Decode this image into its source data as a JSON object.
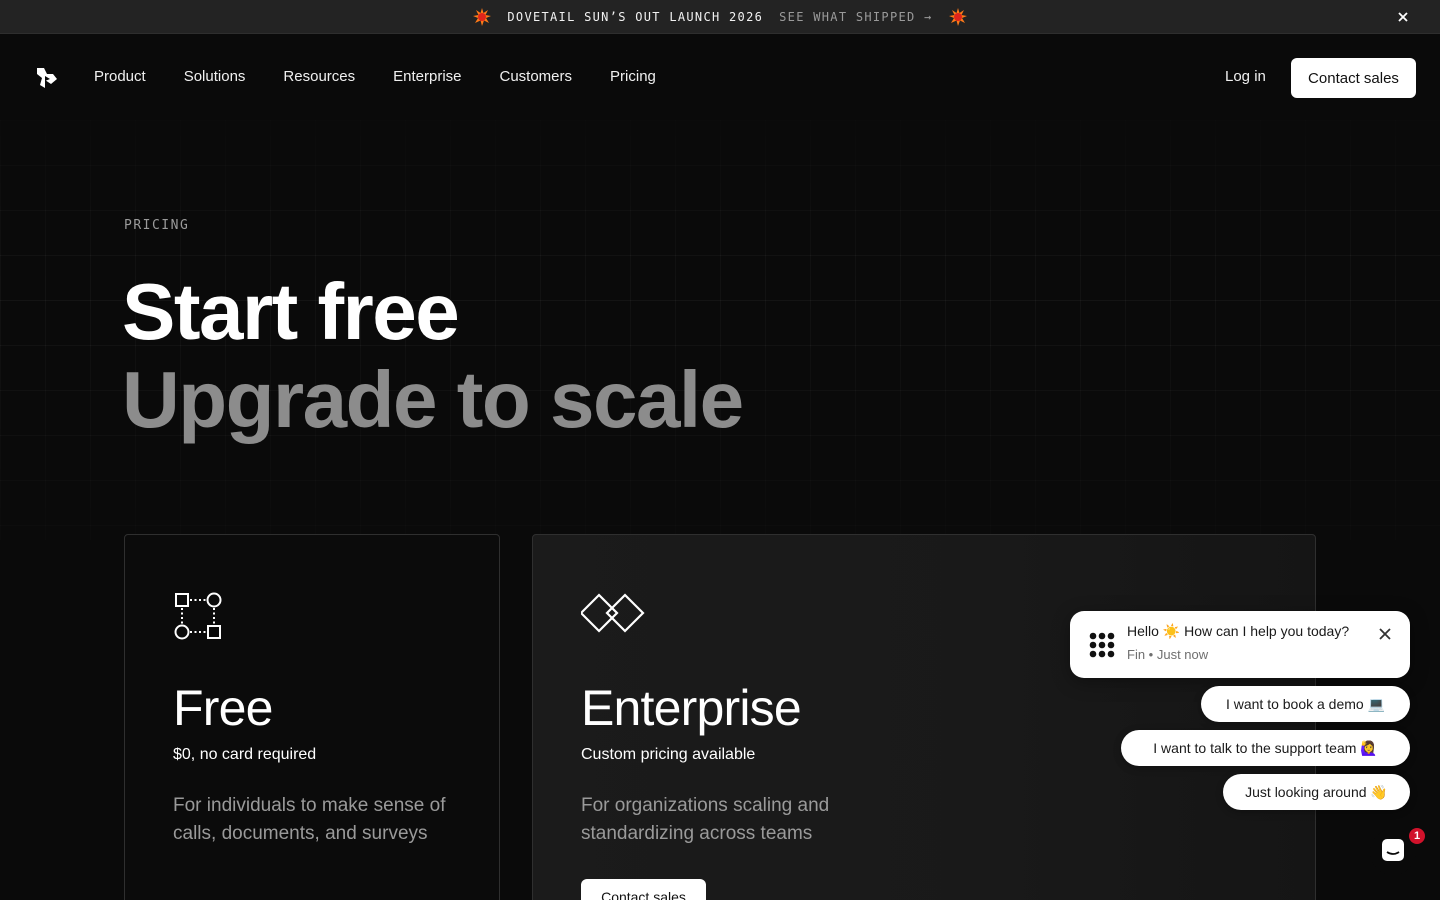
{
  "announcement": {
    "title": "DOVETAIL SUN’S OUT LAUNCH 2026",
    "link": "SEE WHAT SHIPPED →"
  },
  "nav": {
    "links": [
      "Product",
      "Solutions",
      "Resources",
      "Enterprise",
      "Customers",
      "Pricing"
    ],
    "login": "Log in",
    "contact": "Contact sales"
  },
  "hero": {
    "eyebrow": "PRICING",
    "line1": "Start free",
    "line2": "Upgrade to scale"
  },
  "plans": [
    {
      "name": "Free",
      "price": "$0, no card required",
      "description": "For individuals to make sense of calls, documents, and surveys"
    },
    {
      "name": "Enterprise",
      "price": "Custom pricing available",
      "description": "For organizations scaling and standardizing across teams",
      "cta": "Contact sales"
    }
  ],
  "chat": {
    "message": "Hello ☀️ How can I help you today?",
    "sender": "Fin",
    "time": "Just now",
    "meta": "Fin • Just now",
    "options": [
      "I want to book a demo 💻",
      "I want to talk to the support team 🙋‍♀️",
      "Just looking around 👋"
    ],
    "unread_count": "1"
  },
  "colors": {
    "background": "#0a0a0a",
    "banner": "#232323",
    "muted_heading": "#8c8c8c",
    "badge": "#d1122b"
  }
}
